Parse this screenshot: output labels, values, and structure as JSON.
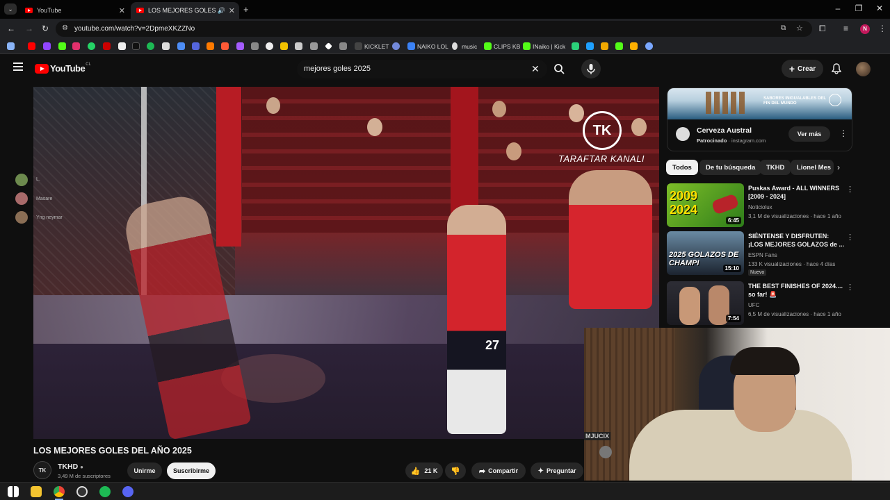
{
  "browser": {
    "tabs": [
      {
        "label": "YouTube",
        "active": false
      },
      {
        "label": "LOS MEJORES GOLES DEL A",
        "active": true
      }
    ],
    "url": "youtube.com/watch?v=2DpmeXKZZNo",
    "bookmarks": [
      "KICKLET",
      "NAIKO LOL",
      "music",
      "CLIPS KB",
      "INaiko | Kick"
    ],
    "profile_initial": "N"
  },
  "youtube": {
    "logo_text": "YouTube",
    "logo_region": "CL",
    "search_query": "mejores goles 2025",
    "create_label": "Crear"
  },
  "video": {
    "overlay_brand": "TARAFTAR KANALI",
    "overlay_logo": "TK",
    "title": "LOS MEJORES GOLES DEL AÑO 2025",
    "channel": {
      "name": "TKHD",
      "subscribers": "3,49 M de suscriptores",
      "avatar_text": "TK"
    },
    "buttons": {
      "join": "Unirme",
      "subscribe": "Suscribirme",
      "likes": "21 K",
      "share": "Compartir",
      "ask": "Preguntar"
    },
    "chat_users": [
      "L.",
      "Masare",
      "Yng neymar"
    ],
    "player_number": "27"
  },
  "ad": {
    "banner_text": "SABORES INIGUALABLES DEL FIN DEL MUNDO",
    "name": "Cerveza Austral",
    "sponsored": "Patrocinado",
    "domain": "instagram.com",
    "cta": "Ver más"
  },
  "chips": [
    "Todos",
    "De tu búsqueda",
    "TKHD",
    "Lionel Mes"
  ],
  "recommendations": [
    {
      "title": "Puskas Award - ALL WINNERS [2009 - 2024]",
      "channel": "Noticiolux",
      "meta": "3,1 M de visualizaciones · hace 1 año",
      "duration": "6:45",
      "thumb_text": "2009 2024",
      "badge": ""
    },
    {
      "title": "SIÉNTENSE Y DISFRUTEN: ¡LOS MEJORES GOLAZOS de ...",
      "channel": "ESPN Fans",
      "meta": "133 K visualizaciones · hace 4 días",
      "duration": "15:10",
      "thumb_text": "2025 GOLAZOS DE CHAMPI",
      "badge": "Nuevo"
    },
    {
      "title": "THE BEST FINISHES OF 2024.... so far! 🚨",
      "channel": "UFC",
      "meta": "6,5 M de visualizaciones · hace 1 año",
      "duration": "7:54",
      "thumb_text": "",
      "badge": ""
    }
  ],
  "webcam": {
    "overlay_text": "MJUCIX"
  }
}
